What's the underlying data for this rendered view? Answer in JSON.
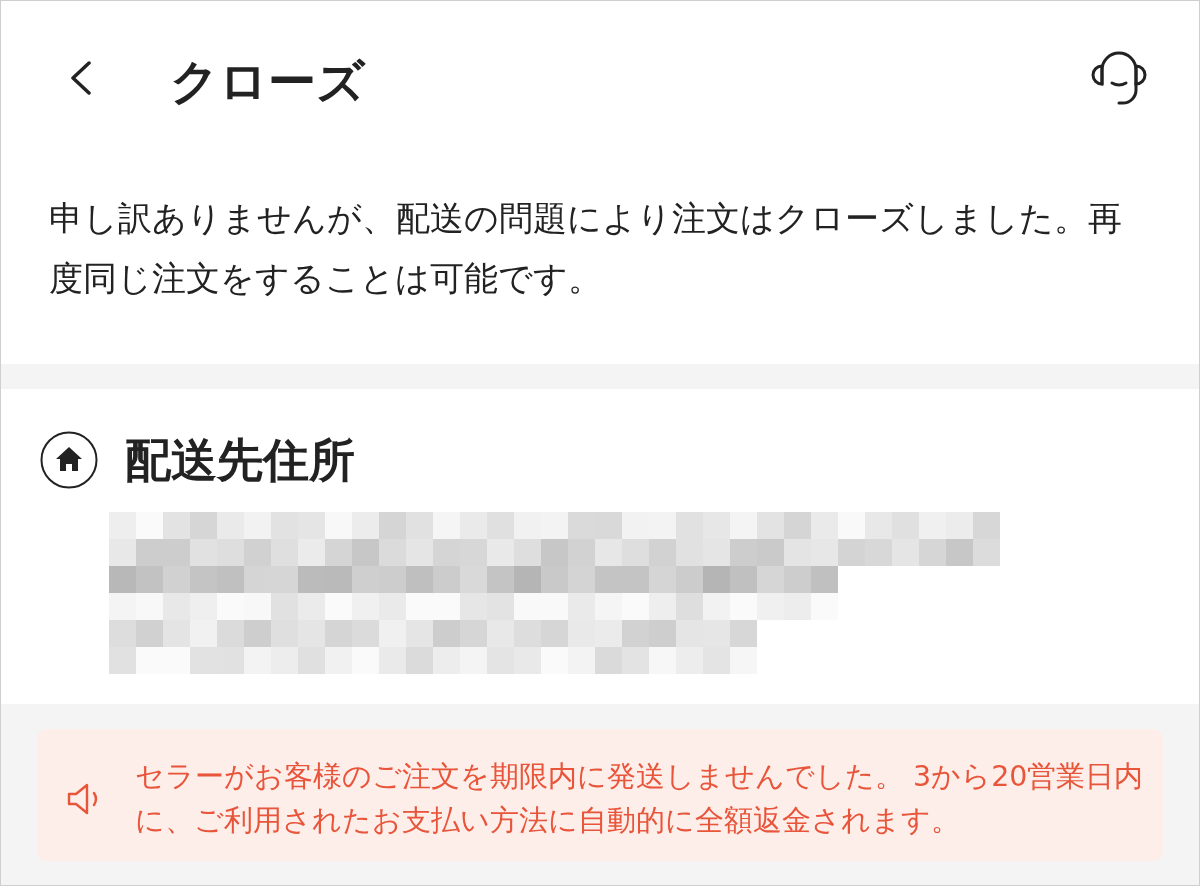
{
  "header": {
    "title": "クローズ"
  },
  "message": "申し訳ありませんが、配送の問題により注文はクローズしました。再度同じ注文をすることは可能です。",
  "address_section": {
    "title": "配送先住所"
  },
  "notice": {
    "text": "セラーがお客様のご注文を期限内に発送しませんでした。 3から20営業日内に、ご利用されたお支払い方法に自動的に全額返金されます。"
  }
}
